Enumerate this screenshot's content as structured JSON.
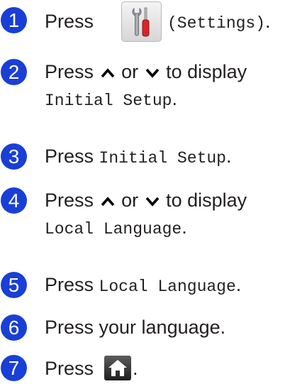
{
  "steps": [
    {
      "number": "1",
      "press": "Press",
      "settings_label": "(Settings)",
      "end": "."
    },
    {
      "number": "2",
      "press": "Press",
      "or": "or",
      "to_display": "to display",
      "target": "Initial Setup",
      "end": "."
    },
    {
      "number": "3",
      "press": "Press",
      "target": "Initial Setup",
      "end": "."
    },
    {
      "number": "4",
      "press": "Press",
      "or": "or",
      "to_display": "to display",
      "target": "Local Language",
      "end": "."
    },
    {
      "number": "5",
      "press": "Press",
      "target": "Local Language",
      "end": "."
    },
    {
      "number": "6",
      "text": "Press your language."
    },
    {
      "number": "7",
      "press": "Press",
      "end": "."
    }
  ],
  "icons": {
    "settings": "settings-wrench-screwdriver-icon",
    "home": "home-icon",
    "up": "chevron-up-icon",
    "down": "chevron-down-icon"
  },
  "colors": {
    "step_badge": "#1a3fd6",
    "text": "#231f20",
    "screwdriver_handle": "#d9252a"
  }
}
